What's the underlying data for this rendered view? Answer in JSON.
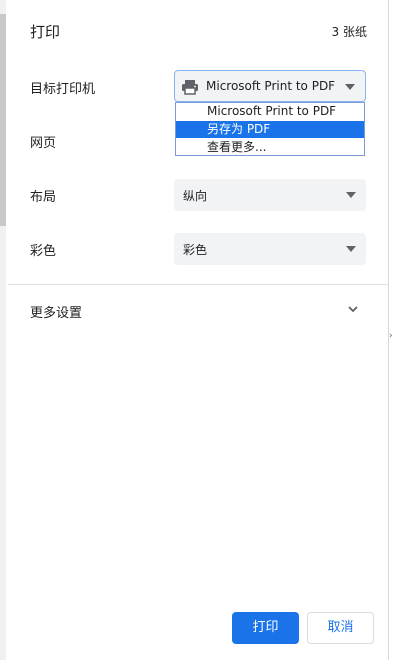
{
  "header": {
    "title": "打印",
    "sheet_count": "3 张纸"
  },
  "rows": {
    "destination": {
      "label": "目标打印机",
      "value": "Microsoft Print to PDF"
    },
    "pages": {
      "label": "网页"
    },
    "layout": {
      "label": "布局",
      "value": "纵向"
    },
    "color": {
      "label": "彩色",
      "value": "彩色"
    }
  },
  "dropdown": {
    "options": [
      "Microsoft Print to PDF",
      "另存为 PDF",
      "查看更多..."
    ],
    "highlighted": "另存为 PDF"
  },
  "more_settings": {
    "label": "更多设置"
  },
  "footer": {
    "print_label": "打印",
    "cancel_label": "取消"
  },
  "colors": {
    "accent": "#1a73e8",
    "field_bg": "#f1f3f4",
    "text": "#202124",
    "divider": "#e0e0e0"
  }
}
